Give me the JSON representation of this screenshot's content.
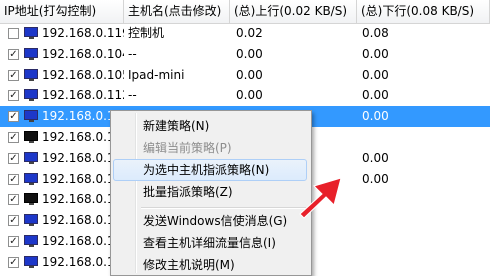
{
  "columns": [
    "IP地址(打勾控制)",
    "主机名(点击修改)",
    "(总)上行(0.02 KB/S)",
    "(总)下行(0.08 KB/S)"
  ],
  "rows": [
    {
      "ip": "192.168.0.119",
      "name": "控制机",
      "up": "0.02",
      "down": "0.08",
      "checked": false,
      "monitor": "blue",
      "selected": false
    },
    {
      "ip": "192.168.0.104",
      "name": "--",
      "up": "0.00",
      "down": "0.00",
      "checked": true,
      "monitor": "blue",
      "selected": false
    },
    {
      "ip": "192.168.0.105",
      "name": "Ipad-mini",
      "up": "0.00",
      "down": "0.00",
      "checked": true,
      "monitor": "blue",
      "selected": false
    },
    {
      "ip": "192.168.0.112",
      "name": "--",
      "up": "0.00",
      "down": "0.00",
      "checked": true,
      "monitor": "blue",
      "selected": false
    },
    {
      "ip": "192.168.0.1",
      "name": "",
      "up": "0.00",
      "down": "0.00",
      "checked": true,
      "monitor": "blue",
      "selected": true
    },
    {
      "ip": "192.168.0.1",
      "name": "",
      "up": "",
      "down": "",
      "checked": true,
      "monitor": "dark",
      "selected": false
    },
    {
      "ip": "192.168.0.1",
      "name": "",
      "up": "",
      "down": "0.00",
      "checked": true,
      "monitor": "blue",
      "selected": false
    },
    {
      "ip": "192.168.0.1",
      "name": "",
      "up": "",
      "down": "0.00",
      "checked": true,
      "monitor": "blue",
      "selected": false
    },
    {
      "ip": "192.168.0.1",
      "name": "",
      "up": "",
      "down": "",
      "checked": true,
      "monitor": "dark",
      "selected": false
    },
    {
      "ip": "192.168.0.1",
      "name": "",
      "up": "",
      "down": "",
      "checked": true,
      "monitor": "blue",
      "selected": false
    },
    {
      "ip": "192.168.0.1",
      "name": "",
      "up": "",
      "down": "",
      "checked": true,
      "monitor": "blue",
      "selected": false
    },
    {
      "ip": "192.168.0.1",
      "name": "",
      "up": "",
      "down": "",
      "checked": true,
      "monitor": "blue",
      "selected": false
    }
  ],
  "menu": {
    "new_policy": "新建策略(N)",
    "edit_policy": "编辑当前策略(P)",
    "assign_policy": "为选中主机指派策略(N)",
    "batch_assign": "批量指派策略(Z)",
    "send_message": "发送Windows信使消息(G)",
    "view_traffic": "查看主机详细流量信息(I)",
    "edit_note": "修改主机说明(M)"
  },
  "colors": {
    "selection": "#3399ff",
    "arrow": "#e8202a"
  },
  "icons": {
    "check": "✓",
    "monitor": "monitor-icon"
  }
}
